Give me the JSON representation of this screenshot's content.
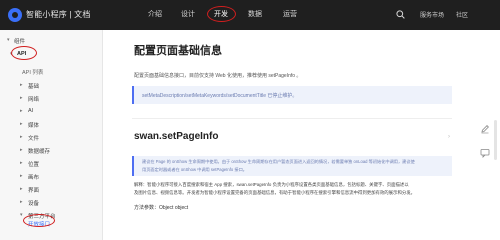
{
  "header": {
    "brand": "智能小程序 | 文档",
    "nav": [
      "介绍",
      "设计",
      "开发",
      "数据",
      "运营"
    ],
    "active_nav": "开发",
    "links": [
      "服务市场",
      "社区"
    ],
    "icons": {
      "logo": "swan-logo-icon",
      "search": "search-icon"
    }
  },
  "sidebar": {
    "items": [
      {
        "label": "组件",
        "arrow": "▾"
      },
      {
        "label": "API",
        "arrow": "▾"
      },
      {
        "label": "API 列表",
        "arrow": ""
      },
      {
        "label": "基础",
        "arrow": "▸"
      },
      {
        "label": "网络",
        "arrow": "▸"
      },
      {
        "label": "AI",
        "arrow": "▸"
      },
      {
        "label": "媒体",
        "arrow": "▸"
      },
      {
        "label": "文件",
        "arrow": "▸"
      },
      {
        "label": "数据缓存",
        "arrow": "▸"
      },
      {
        "label": "位置",
        "arrow": "▸"
      },
      {
        "label": "画布",
        "arrow": "▸"
      },
      {
        "label": "界面",
        "arrow": "▸"
      },
      {
        "label": "设备",
        "arrow": "▸"
      },
      {
        "label": "第三方平台",
        "arrow": "▾"
      },
      {
        "label": "开放接口",
        "arrow": ""
      }
    ]
  },
  "main": {
    "title": "配置页面基础信息",
    "intro": "配置页面基础信息接口，目前仅支持 Web 化使用，推荐使用 setPageInfo 。",
    "note1": "setMetaDescription/setMetaKeywords/setDocumentTitle 已停止维护。",
    "section_title": "swan.setPageInfo",
    "note2_line1": "建议在 Page 的 onShow 生命周期中使用。由于 onShow 生命周期存在用户暂态页面进入返回的情况，若需要单独 onLoad 等初始化中调用，建议使",
    "note2_line2": "用页面定时器或者在 onShow 中调用 setPageInfo 接口。",
    "desc_line1": "解释：智能小程序可接入百度搜索和宿主 App 搜索，swan.setPageInfo 负责为小程序设置各类页面基础信息，包括标题、关键字、页面描述以",
    "desc_line2": "及图片信息、视频信息等。开发者为智能小程序设置完备的页面基础信息，有助于智能小程序在搜索引擎和信息流中得到更加有效的展示和分发。",
    "method_param": "方法参数：Object object"
  },
  "right_tools": {
    "icons": [
      "edit-icon",
      "feedback-icon"
    ]
  },
  "colors": {
    "topbar": "#1f1f1f",
    "accent": "#4e6ef2",
    "highlight": "#d11f1f",
    "note_bg": "#eef2fb"
  }
}
